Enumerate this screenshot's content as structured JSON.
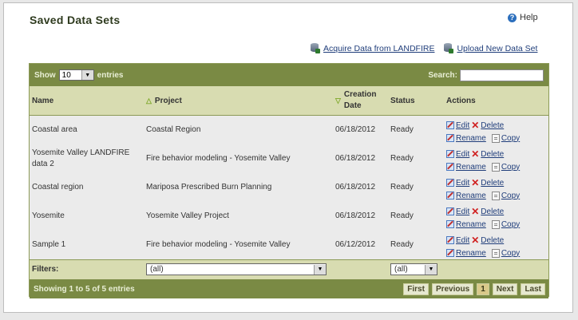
{
  "page": {
    "title": "Saved Data Sets",
    "help_label": "Help",
    "help_icon": "help-icon"
  },
  "top_actions": [
    {
      "label": "Acquire Data from LANDFIRE",
      "icon": "database-icon"
    },
    {
      "label": "Upload New Data Set",
      "icon": "database-icon"
    }
  ],
  "table": {
    "show_label": "Show",
    "entries_label": "entries",
    "page_length": "10",
    "search_label": "Search:",
    "search_value": "",
    "columns": [
      "Name",
      "Project",
      "Creation Date",
      "Status",
      "Actions"
    ],
    "sort": {
      "project": "ascending",
      "creation_date": "descending"
    },
    "rows": [
      {
        "name": "Coastal area",
        "project": "Coastal Region",
        "date": "06/18/2012",
        "status": "Ready"
      },
      {
        "name": "Yosemite Valley LANDFIRE data 2",
        "project": "Fire behavior modeling - Yosemite Valley",
        "date": "06/18/2012",
        "status": "Ready"
      },
      {
        "name": "Coastal region",
        "project": "Mariposa Prescribed Burn Planning",
        "date": "06/18/2012",
        "status": "Ready"
      },
      {
        "name": "Yosemite",
        "project": "Yosemite Valley Project",
        "date": "06/18/2012",
        "status": "Ready"
      },
      {
        "name": "Sample 1",
        "project": "Fire behavior modeling - Yosemite Valley",
        "date": "06/12/2012",
        "status": "Ready"
      }
    ],
    "row_actions": {
      "edit": "Edit",
      "delete": "Delete",
      "rename": "Rename",
      "copy": "Copy"
    },
    "filters_label": "Filters:",
    "project_filter": "(all)",
    "status_filter": "(all)",
    "info": "Showing 1 to 5 of 5 entries",
    "pager": {
      "first": "First",
      "previous": "Previous",
      "current": "1",
      "next": "Next",
      "last": "Last"
    }
  },
  "colors": {
    "header_bar": "#7a8a44",
    "header_row": "#d8dcb1",
    "row_bg": "#ebebeb",
    "link": "#1f3d7a"
  }
}
